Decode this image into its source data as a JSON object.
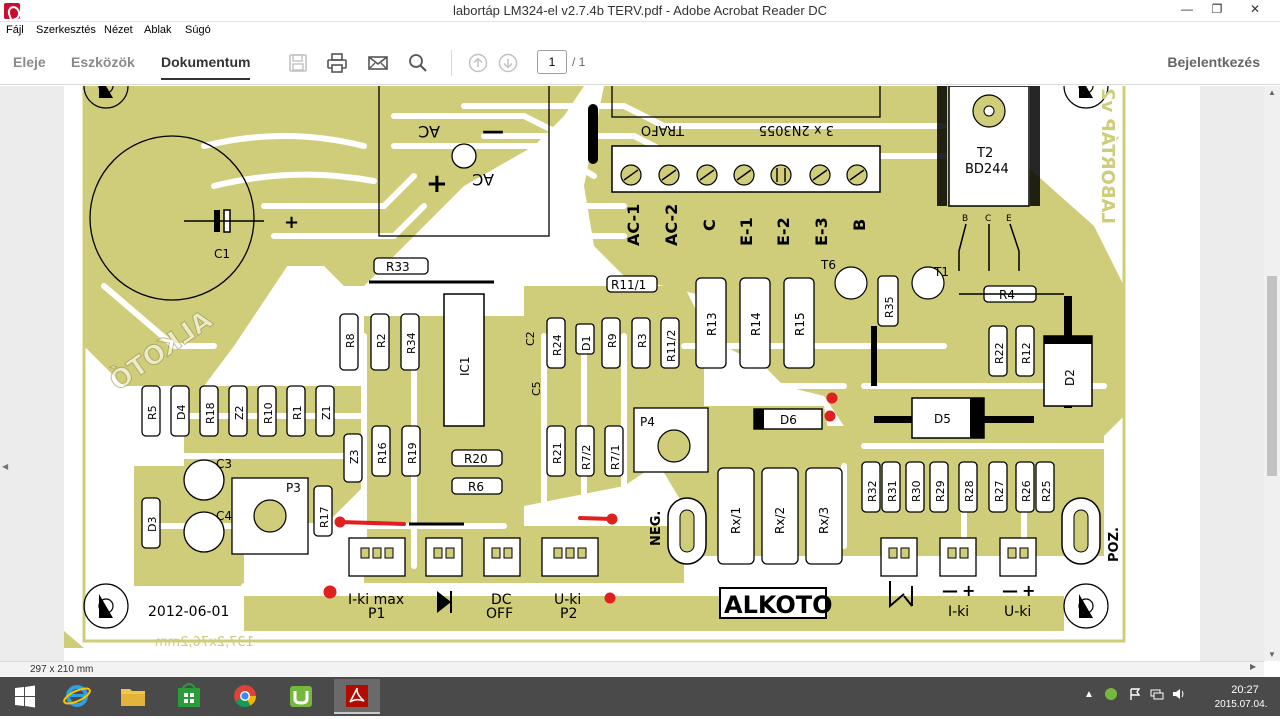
{
  "window": {
    "title": "labortáp LM324-el v2.7.4b TERV.pdf - Adobe Acrobat Reader DC",
    "min": "—",
    "max": "❐",
    "close": "✕"
  },
  "menu": [
    "Fájl",
    "Szerkesztés",
    "Nézet",
    "Ablak",
    "Súgó"
  ],
  "toolbar": {
    "tabs": [
      "Eleje",
      "Eszközök",
      "Dokumentum"
    ],
    "active_tab": "Dokumentum",
    "page_current": "1",
    "page_total": "/ 1",
    "signin": "Bejelentkezés",
    "icons": [
      "save-icon",
      "print-icon",
      "email-icon",
      "search-icon",
      "page-up-icon",
      "page-down-icon"
    ]
  },
  "status": {
    "page_size": "297 x 210 mm"
  },
  "pcb": {
    "date": "2012-06-01",
    "dims_mirrored": "137,2x76,2mm",
    "brand": "ALKOTO",
    "brand_mirrored": "ALKOTÓ",
    "version_mirrored": "LABORTÁP v2.7.4b",
    "trafo": "TRAFO",
    "transistors_label": "3 x 2N3055",
    "terminals": [
      "AC-1",
      "AC-2",
      "C",
      "E-1",
      "E-2",
      "E-3",
      "B"
    ],
    "bridge_ac_1": "AC",
    "bridge_ac_2": "AC",
    "bridge_minus": "—",
    "bridge_plus": "+",
    "cap_plus": "+",
    "t2_name": "T2",
    "t2_part": "BD244",
    "t2_pins": [
      "B",
      "C",
      "E"
    ],
    "components": {
      "c1": "C1",
      "r33": "R33",
      "r11_1": "R11/1",
      "r8": "R8",
      "r2": "R2",
      "r34": "R34",
      "ic1": "IC1",
      "c2": "C2",
      "r24": "R24",
      "d1": "D1",
      "r9": "R9",
      "r3": "R3",
      "r11_2": "R11/2",
      "r13": "R13",
      "r14": "R14",
      "r15": "R15",
      "t6": "T6",
      "r35": "R35",
      "t1": "T1",
      "r4": "R4",
      "r22": "R22",
      "r12": "R12",
      "d2": "D2",
      "d5": "D5",
      "d6": "D6",
      "r5": "R5",
      "d4": "D4",
      "r18": "R18",
      "z2": "Z2",
      "r10": "R10",
      "r1": "R1",
      "z1": "Z1",
      "c5": "C5",
      "z3": "Z3",
      "r16": "R16",
      "r19": "R19",
      "r20": "R20",
      "r6": "R6",
      "r21": "R21",
      "r7_2": "R7/2",
      "r7_1": "R7/1",
      "p4": "P4",
      "c3": "C3",
      "c4": "C4",
      "d3": "D3",
      "p3": "P3",
      "r17": "R17",
      "rx1": "Rx/1",
      "rx2": "Rx/2",
      "rx3": "Rx/3",
      "r32": "R32",
      "r31": "R31",
      "r30": "R30",
      "r29": "R29",
      "r28": "R28",
      "r27": "R27",
      "r26": "R26",
      "r25": "R25"
    },
    "neg": "NEG.",
    "poz": "POZ.",
    "connectors": {
      "iki_max": "I-ki max",
      "p1": "P1",
      "dc": "DC",
      "off": "OFF",
      "uki": "U-ki",
      "p2": "P2",
      "iki": "I-ki",
      "uki2": "U-ki",
      "minus": "—",
      "plus": "+"
    },
    "colors": {
      "copper": "#cfcc7a",
      "board": "#ffffff",
      "mark": "#e02020"
    }
  },
  "taskbar": {
    "apps": [
      "windows-start-icon",
      "internet-explorer-icon",
      "file-explorer-icon",
      "store-icon",
      "chrome-icon",
      "utorrent-icon",
      "acrobat-icon"
    ],
    "time": "20:27",
    "date": "2015.07.04."
  }
}
